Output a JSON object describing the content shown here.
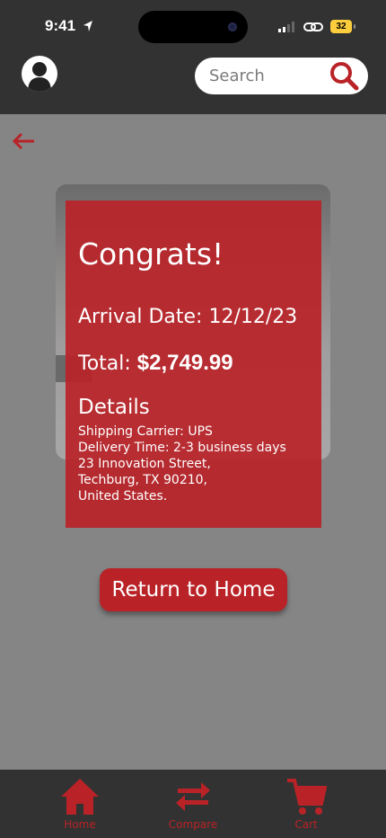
{
  "status_bar": {
    "time": "9:41",
    "battery": "32"
  },
  "search": {
    "placeholder": "Search"
  },
  "card": {
    "title": "Congrats!",
    "arrival_label": "Arrival Date:",
    "arrival_date": "12/12/23",
    "total_label": "Total:",
    "total_value": "$2,749.99",
    "details_title": "Details",
    "details_lines": [
      "Shipping Carrier: UPS",
      "Delivery Time: 2-3 business days",
      "23 Innovation Street,",
      "Techburg, TX 90210,",
      "United States."
    ]
  },
  "return_button": "Return to Home",
  "tabs": [
    {
      "label": "Home",
      "icon": "home-icon"
    },
    {
      "label": "Compare",
      "icon": "compare-icon"
    },
    {
      "label": "Cart",
      "icon": "cart-icon"
    }
  ],
  "colors": {
    "accent": "#b92327",
    "header": "#323232",
    "overlay": "#858586"
  }
}
